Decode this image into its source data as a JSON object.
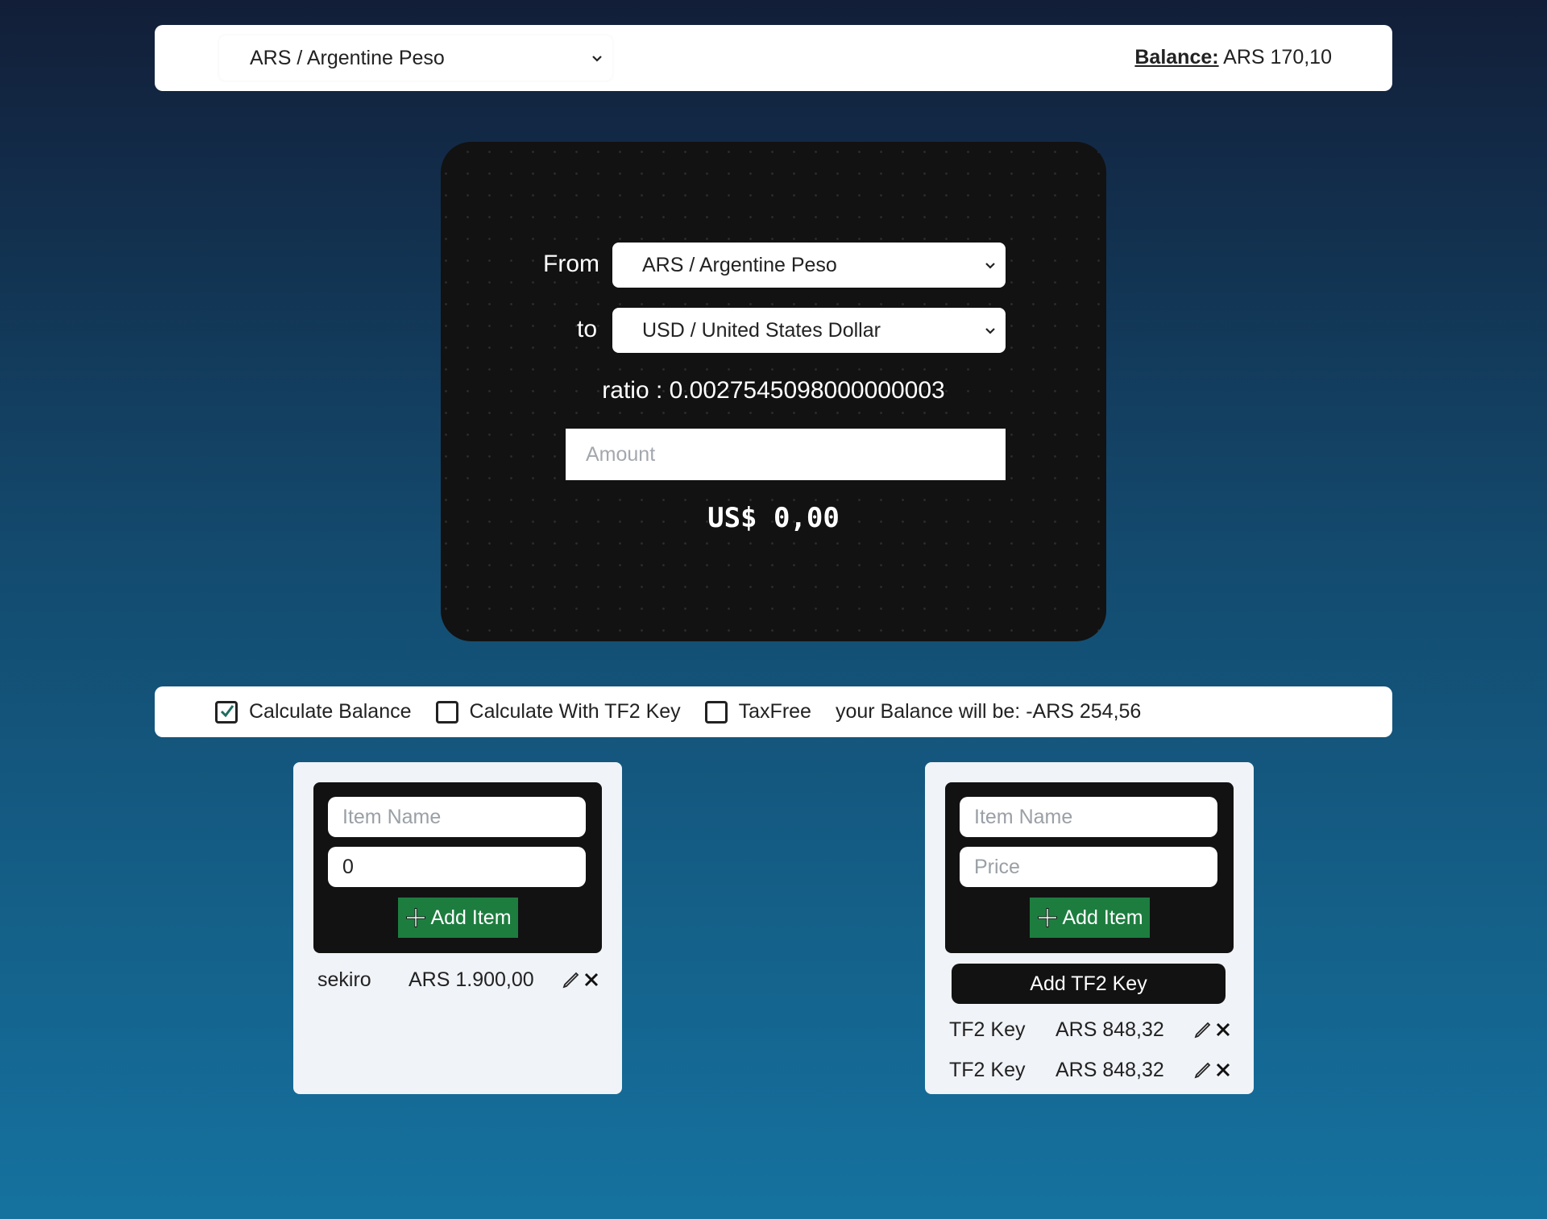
{
  "header": {
    "currency_select": "ARS / Argentine Peso",
    "balance_label": "Balance:",
    "balance_value": "ARS 170,10"
  },
  "converter": {
    "from_label": "From",
    "from_value": "ARS / Argentine Peso",
    "to_label": "to",
    "to_value": "USD / United States Dollar",
    "ratio_text": "ratio : 0.0027545098000000003",
    "amount_placeholder": "Amount",
    "result": "US$ 0,00"
  },
  "options": {
    "calc_balance": {
      "label": "Calculate Balance",
      "checked": true
    },
    "calc_tf2": {
      "label": "Calculate With TF2 Key",
      "checked": false
    },
    "taxfree": {
      "label": "TaxFree",
      "checked": false
    },
    "balance_result": "your Balance will be: -ARS 254,56"
  },
  "left_panel": {
    "name_placeholder": "Item Name",
    "price_value": "0",
    "add_label": "Add Item",
    "items": [
      {
        "name": "sekiro",
        "price": "ARS 1.900,00"
      }
    ]
  },
  "right_panel": {
    "name_placeholder": "Item Name",
    "price_placeholder": "Price",
    "add_label": "Add Item",
    "tf2_button": "Add TF2 Key",
    "items": [
      {
        "name": "TF2 Key",
        "price": "ARS 848,32"
      },
      {
        "name": "TF2 Key",
        "price": "ARS 848,32"
      }
    ]
  },
  "colors": {
    "add_button": "#1d7d3f",
    "converter_bg": "#121212",
    "panel_bg": "#f0f3f7"
  }
}
